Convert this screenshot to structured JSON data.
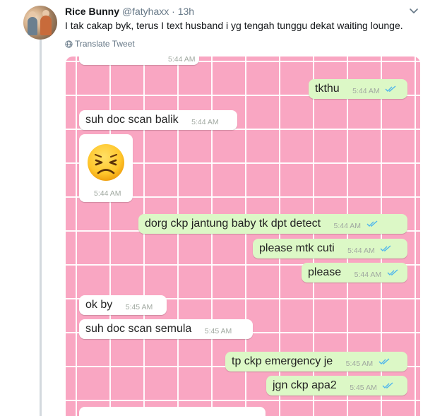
{
  "tweet": {
    "author_name": "Rice Bunny",
    "handle": "@fatyhaxx",
    "separator": "·",
    "time": "13h",
    "text": "I tak cakap byk, terus I text husband i yg tengah tunggu dekat waiting lounge.",
    "translate_label": "Translate Tweet"
  },
  "chat": {
    "top_partial": {
      "text": "...",
      "time": "5:44 AM"
    },
    "messages": [
      {
        "dir": "out",
        "text": "tkthu",
        "time": "5:44 AM"
      },
      {
        "dir": "in",
        "text": "suh doc scan balik",
        "time": "5:44 AM"
      },
      {
        "dir": "in",
        "sticker": "persevering-face-emoji",
        "time": "5:44 AM"
      },
      {
        "dir": "out",
        "text": "dorg ckp jantung baby tk dpt detect",
        "time": "5:44 AM"
      },
      {
        "dir": "out",
        "text": "please mtk cuti",
        "time": "5:44 AM"
      },
      {
        "dir": "out",
        "text": "please",
        "time": "5:44 AM"
      },
      {
        "dir": "in",
        "text": "ok by",
        "time": "5:45 AM"
      },
      {
        "dir": "in",
        "text": "suh doc scan semula",
        "time": "5:45 AM"
      },
      {
        "dir": "out",
        "text": "tp ckp emergency je",
        "time": "5:45 AM"
      },
      {
        "dir": "out",
        "text": "jgn ckp apa2",
        "time": "5:45 AM"
      }
    ],
    "bottom_partial": {
      "text": "..."
    }
  },
  "colors": {
    "wallpaper": "#f9a6c2",
    "incoming_bubble": "#ffffff",
    "outgoing_bubble": "#dcf8c6",
    "read_ticks": "#4fb6ec",
    "thread_line": "#d3d9de"
  },
  "icons": [
    "chevron-down-icon",
    "globe-icon",
    "double-check-icon",
    "persevering-face-emoji"
  ]
}
